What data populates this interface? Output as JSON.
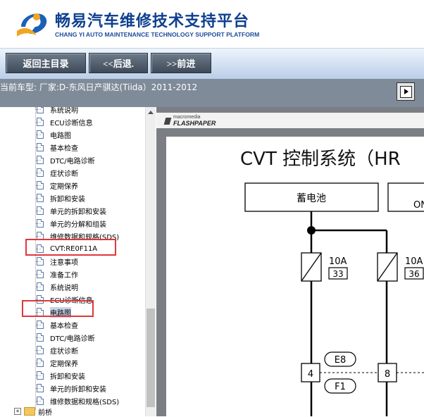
{
  "header": {
    "title": "畅易汽车维修技术支持平台",
    "subtitle": "CHANG YI AUTO MAINTENANCE TECHNOLOGY SUPPORT PLATFORM"
  },
  "toolbar": {
    "home_label": "返回主目录",
    "back_label": "<<后退.",
    "forward_label": ">>前进"
  },
  "model_bar": {
    "text": "当前车型:  厂家:D-东风日产骐达(Tiida）2011-2012"
  },
  "tree": {
    "items": [
      {
        "label": "系统说明",
        "partial": true
      },
      {
        "label": "ECU诊断信息"
      },
      {
        "label": "电路图"
      },
      {
        "label": "基本检查"
      },
      {
        "label": "DTC/电路诊断"
      },
      {
        "label": "症状诊断"
      },
      {
        "label": "定期保养"
      },
      {
        "label": "拆卸和安装"
      },
      {
        "label": "单元的拆卸和安装"
      },
      {
        "label": "单元的分解和组装"
      },
      {
        "label": "维修数据和规格(SDS)"
      },
      {
        "label": "CVT:RE0F11A"
      },
      {
        "label": "注意事项"
      },
      {
        "label": "准备工作"
      },
      {
        "label": "系统说明"
      },
      {
        "label": "ECU诊断信息"
      },
      {
        "label": "电路图",
        "selected": true
      },
      {
        "label": "基本检查"
      },
      {
        "label": "DTC/电路诊断"
      },
      {
        "label": "症状诊断"
      },
      {
        "label": "定期保养"
      },
      {
        "label": "拆卸和安装"
      },
      {
        "label": "单元的拆卸和安装"
      },
      {
        "label": "维修数据和规格(SDS)"
      }
    ],
    "folder_label": "前桥",
    "folder_expander": "+"
  },
  "viewer": {
    "brand_small": "macromedia",
    "brand_big": "FLASHPAPER"
  },
  "diagram": {
    "title": "CVT 控制系统（HR",
    "battery_label": "蓄电池",
    "box2_label": "ON",
    "fuse1": {
      "amp": "10A",
      "number": "33"
    },
    "fuse2": {
      "amp": "10A",
      "number": "36"
    },
    "conn1_pin": "4",
    "conn2_pin": "8",
    "conn_top_label": "E8",
    "conn_bottom_label": "F1"
  },
  "colors": {
    "brand_blue": "#0d3f8f",
    "highlight_red": "#e0373b",
    "model_bar_bg": "#7f8b99"
  }
}
